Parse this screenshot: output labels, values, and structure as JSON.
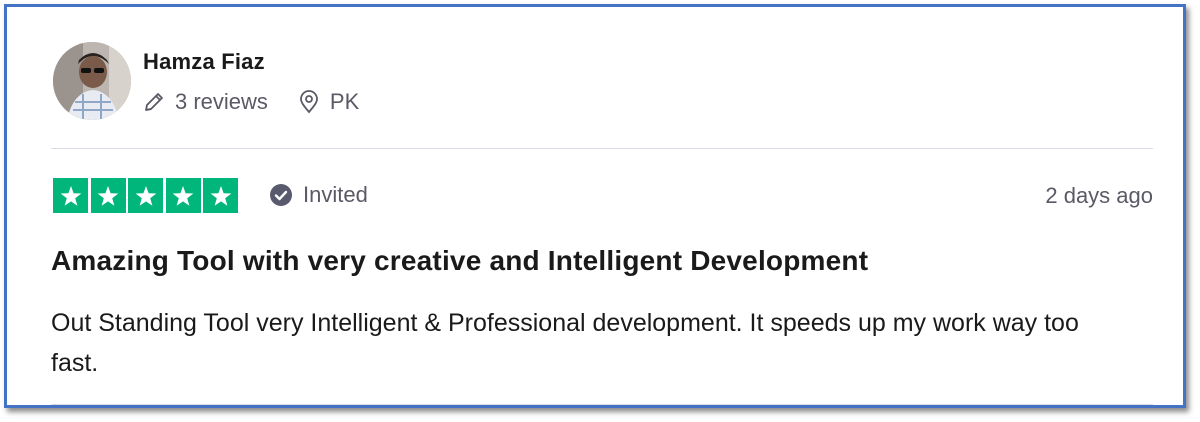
{
  "reviewer": {
    "name": "Hamza Fiaz",
    "reviews": "3 reviews",
    "country": "PK"
  },
  "rating": {
    "stars": 5,
    "max": 5,
    "star_color": "#00b67a"
  },
  "badge": {
    "label": "Invited",
    "icon": "check-circle-icon"
  },
  "date": "2 days ago",
  "review": {
    "title": "Amazing Tool with very creative and Intelligent Development",
    "body": "Out Standing Tool very Intelligent & Professional development. It speeds up my work way too fast."
  },
  "colors": {
    "frame_border": "#4472c4",
    "muted_text": "#5a5a66",
    "text": "#1a1a1a"
  }
}
